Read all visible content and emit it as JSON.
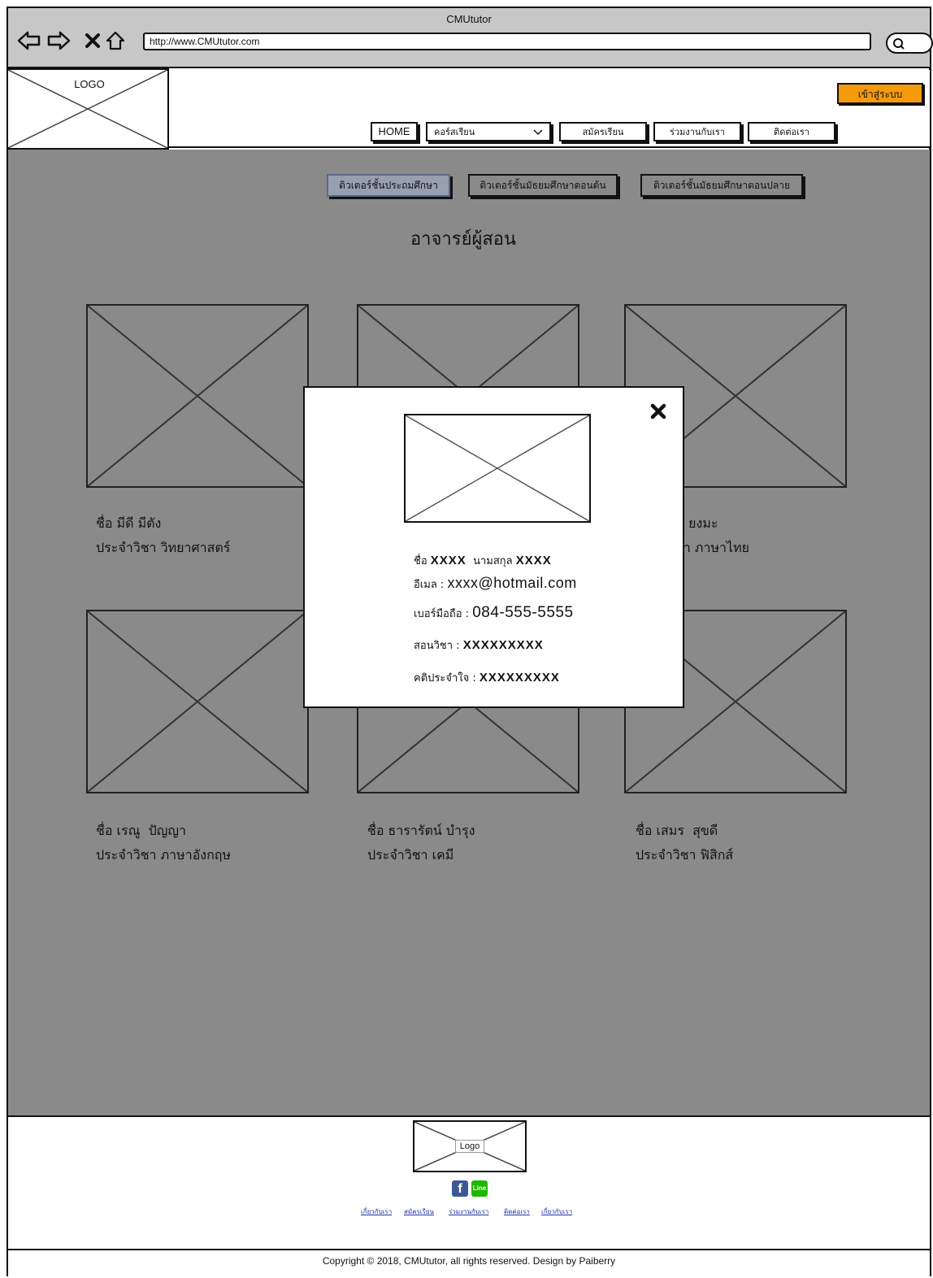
{
  "browser": {
    "title": "CMUtutor",
    "url": "http://www.CMUtutor.com"
  },
  "header": {
    "logo_text": "LOGO",
    "login_label": "เข้าสู่ระบบ",
    "nav": {
      "home": "HOME",
      "courses": "คอร์สเรียน",
      "register": "สมัครเรียน",
      "join": "ร่วมงานกับเรา",
      "contact": "ติดต่อเรา"
    }
  },
  "tabs": [
    {
      "label": "ติวเตอร์ชั้นประถมศึกษา",
      "active": true
    },
    {
      "label": "ติวเตอร์ชั้นมัธยมศึกษาตอนต้น",
      "active": false
    },
    {
      "label": "ติวเตอร์ชั้นมัธยมศึกษาตอนปลาย",
      "active": false
    }
  ],
  "section_title": "อาจารย์ผู้สอน",
  "teachers": [
    {
      "name_line": "ชื่อ มีดี มีตัง",
      "subject_line": "ประจำวิชา วิทยาศาสตร์"
    },
    {
      "name_line": "",
      "subject_line": ""
    },
    {
      "name_line": "น  ยงมะ",
      "subject_line": "ชา ภาษาไทย"
    },
    {
      "name_line": "ชื่อ เรณู  ปัญญา",
      "subject_line": "ประจำวิชา ภาษาอังกฤษ"
    },
    {
      "name_line": "ชื่อ ธารารัตน์ บำรุง",
      "subject_line": "ประจำวิชา เคมี"
    },
    {
      "name_line": "ชื่อ เสมร  สุขดี",
      "subject_line": "ประจำวิชา ฟิสิกส์"
    }
  ],
  "modal": {
    "first_name_label": "ชื่อ",
    "first_name_value": "XXXX",
    "last_name_label": "นามสกุล",
    "last_name_value": "XXXX",
    "email_label": "อีเมล :",
    "email_value": "xxxx@hotmail.com",
    "phone_label": "เบอร์มือถือ :",
    "phone_value": "084-555-5555",
    "subject_label": "สอนวิชา :",
    "subject_value": "XXXXXXXXX",
    "motto_label": "คติประจำใจ :",
    "motto_value": "XXXXXXXXX"
  },
  "footer": {
    "logo_text": "Logo",
    "social": {
      "facebook": "f",
      "line": "Line"
    },
    "links": [
      "เกี่ยวกับเรา",
      "สมัครเรียน",
      "ร่วมงานกับเรา",
      "ติดต่อเรา",
      "เกี่ยวกับเรา"
    ],
    "copyright": "Copyright © 2018, CMUtutor, all rights reserved. Design by Paiberry"
  },
  "colors": {
    "login_button": "#f59a0a",
    "overlay": "#8a8a8a",
    "facebook": "#3b5998",
    "line": "#1fb600"
  }
}
